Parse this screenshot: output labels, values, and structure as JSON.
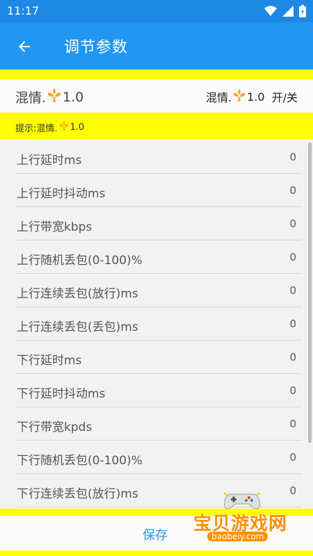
{
  "status_bar": {
    "time": "11:17",
    "icons": [
      "wifi-icon",
      "signal-icon",
      "battery-icon"
    ]
  },
  "app_bar": {
    "back_icon": "arrow-left-icon",
    "title": "调节参数"
  },
  "header": {
    "profile_label": "混情.",
    "profile_version": "1.0",
    "current_label": "混情.",
    "current_version": "1.0",
    "toggle_label": "开/关",
    "emblem_icon": "fleur-de-lis-icon"
  },
  "tip": {
    "prefix": "提示:混情.",
    "version": "1.0"
  },
  "params": [
    {
      "label": "上行延时ms",
      "value": "0"
    },
    {
      "label": "上行延时抖动ms",
      "value": "0"
    },
    {
      "label": "上行带宽kbps",
      "value": "0"
    },
    {
      "label": "上行随机丢包(0-100)%",
      "value": "0"
    },
    {
      "label": "上行连续丢包(放行)ms",
      "value": "0"
    },
    {
      "label": "上行连续丢包(丢包)ms",
      "value": "0"
    },
    {
      "label": "下行延时ms",
      "value": "0"
    },
    {
      "label": "下行延时抖动ms",
      "value": "0"
    },
    {
      "label": "下行带宽kpds",
      "value": "0"
    },
    {
      "label": "下行随机丢包(0-100)%",
      "value": "0"
    },
    {
      "label": "下行连续丢包(放行)ms",
      "value": "0"
    }
  ],
  "bottom": {
    "save_label": "保存"
  },
  "watermark": {
    "cn": "宝贝游戏网",
    "en": "baobeiy.com"
  },
  "colors": {
    "primary": "#2196f3",
    "status_bar": "#1e88e5",
    "highlight": "#ffff00",
    "emblem": "#f5a623",
    "watermark": "#ff8f00"
  }
}
